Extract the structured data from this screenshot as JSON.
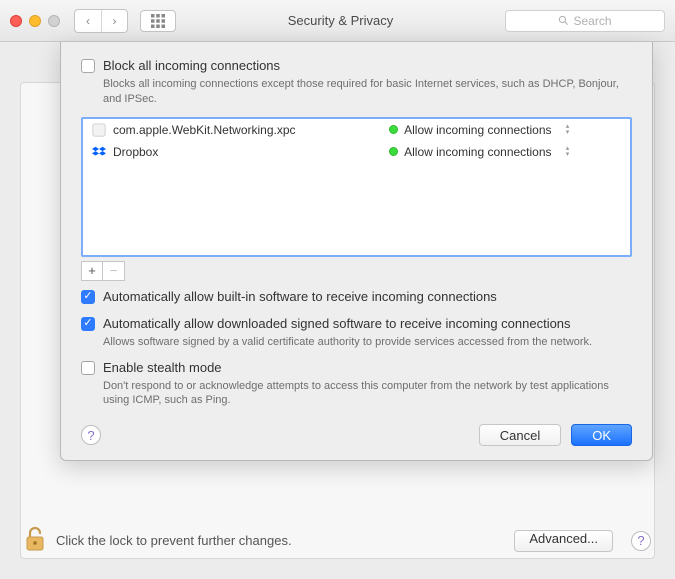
{
  "titlebar": {
    "title": "Security & Privacy",
    "search_placeholder": "Search"
  },
  "sheet": {
    "block_all": {
      "checked": false,
      "label": "Block all incoming connections",
      "sub": "Blocks all incoming connections except those required for basic Internet services, such as DHCP, Bonjour, and IPSec."
    },
    "apps": [
      {
        "icon": "generic",
        "name": "com.apple.WebKit.Networking.xpc",
        "status": "Allow incoming connections"
      },
      {
        "icon": "dropbox",
        "name": "Dropbox",
        "status": "Allow incoming connections"
      }
    ],
    "auto_builtin": {
      "checked": true,
      "label": "Automatically allow built-in software to receive incoming connections"
    },
    "auto_signed": {
      "checked": true,
      "label": "Automatically allow downloaded signed software to receive incoming connections",
      "sub": "Allows software signed by a valid certificate authority to provide services accessed from the network."
    },
    "stealth": {
      "checked": false,
      "label": "Enable stealth mode",
      "sub": "Don't respond to or acknowledge attempts to access this computer from the network by test applications using ICMP, such as Ping."
    },
    "cancel_label": "Cancel",
    "ok_label": "OK"
  },
  "bottom": {
    "lock_text": "Click the lock to prevent further changes.",
    "advanced_label": "Advanced..."
  }
}
